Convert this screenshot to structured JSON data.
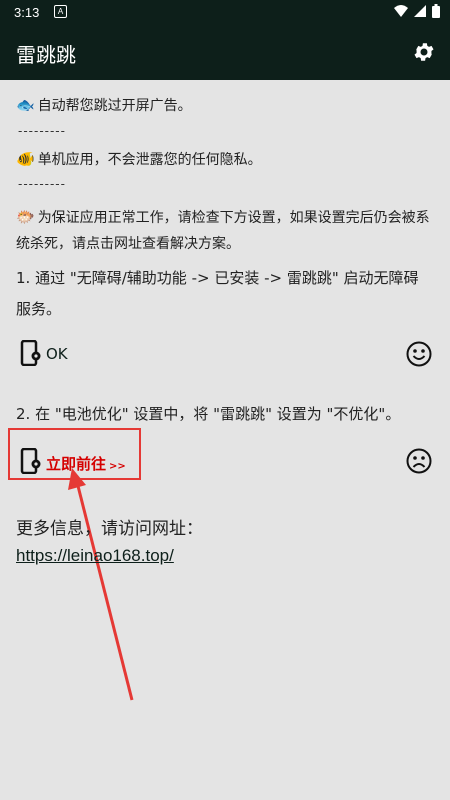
{
  "status_bar": {
    "time": "3:13",
    "notification_icon": "A"
  },
  "app": {
    "title": "雷跳跳"
  },
  "intro": {
    "line1": "自动帮您跳过开屏广告。",
    "sep1": "---------",
    "line2": "单机应用，不会泄露您的任何隐私。",
    "sep2": "---------",
    "line3a": "为保证应用正常工作，请检查下方设置，如果设置完后仍会被系",
    "line3b": "统杀死，请点击网址查看解决方案。"
  },
  "step1": {
    "text_a": "1. 通过 \"无障碍/辅助功能 -> 已安装 -> 雷跳跳\" 启动无障碍",
    "text_b": "服务。",
    "status_label": "OK",
    "status_face": "smile-icon"
  },
  "step2": {
    "text": "2. 在 \"电池优化\" 设置中，将 \"雷跳跳\" 设置为 \"不优化\"。",
    "action_label": "立即前往",
    "action_arrow": ">>",
    "status_face": "frown-icon"
  },
  "more_info": {
    "label": "更多信息，请访问网址：",
    "url": "https://leinao168.top/"
  },
  "colors": {
    "appbar": "#0d1f1a",
    "accent_red": "#d50000",
    "background": "#e4e4e4"
  }
}
